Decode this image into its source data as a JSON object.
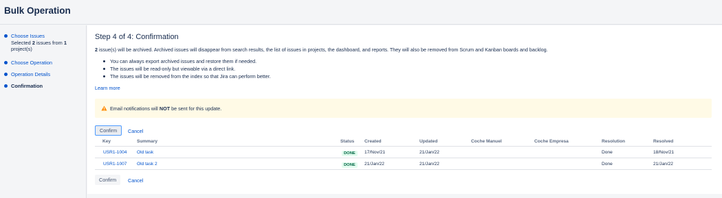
{
  "page": {
    "title": "Bulk Operation"
  },
  "steps": [
    {
      "label": "Choose Issues",
      "detail_pre": "Selected ",
      "detail_count": "2",
      "detail_mid": " issues from ",
      "detail_projects": "1",
      "detail_post": " project(s)"
    },
    {
      "label": "Choose Operation"
    },
    {
      "label": "Operation Details"
    },
    {
      "label": "Confirmation"
    }
  ],
  "main": {
    "step_title": "Step 4 of 4: Confirmation",
    "desc_count": "2",
    "desc_text": " issue(s) will be archived. Archived issues will disappear from search results, the list of issues in projects, the dashboard, and reports. They will also be removed from Scrum and Kanban boards and backlog.",
    "bullets": [
      "You can always export archived issues and restore them if needed.",
      "The issues will be read-only but viewable via a direct link.",
      "The issues will be removed from the index so that Jira can perform better."
    ],
    "learn_more": "Learn more",
    "banner": {
      "pre": "Email notifications will ",
      "strong": "NOT",
      "post": " be sent for this update."
    },
    "confirm_label": "Confirm",
    "cancel_label": "Cancel"
  },
  "table": {
    "headers": [
      "Key",
      "Summary",
      "Status",
      "Created",
      "Updated",
      "Coche Manuel",
      "Coche Empresa",
      "Resolution",
      "Resolved"
    ],
    "rows": [
      {
        "key": "USR1-1004",
        "summary": "Old task",
        "status": "DONE",
        "created": "17/Nov/21",
        "updated": "21/Jan/22",
        "coche_manuel": "",
        "coche_empresa": "",
        "resolution": "Done",
        "resolved": "18/Nov/21"
      },
      {
        "key": "USR1-1007",
        "summary": "Old task 2",
        "status": "DONE",
        "created": "21/Jan/22",
        "updated": "21/Jan/22",
        "coche_manuel": "",
        "coche_empresa": "",
        "resolution": "Done",
        "resolved": "21/Jan/22"
      }
    ]
  },
  "colors": {
    "link": "#0052cc",
    "banner_bg": "#fffae6",
    "warning": "#ff8b00",
    "done_bg": "#e3fcef",
    "done_text": "#006644"
  },
  "icons": {
    "warning": "warning-icon"
  }
}
